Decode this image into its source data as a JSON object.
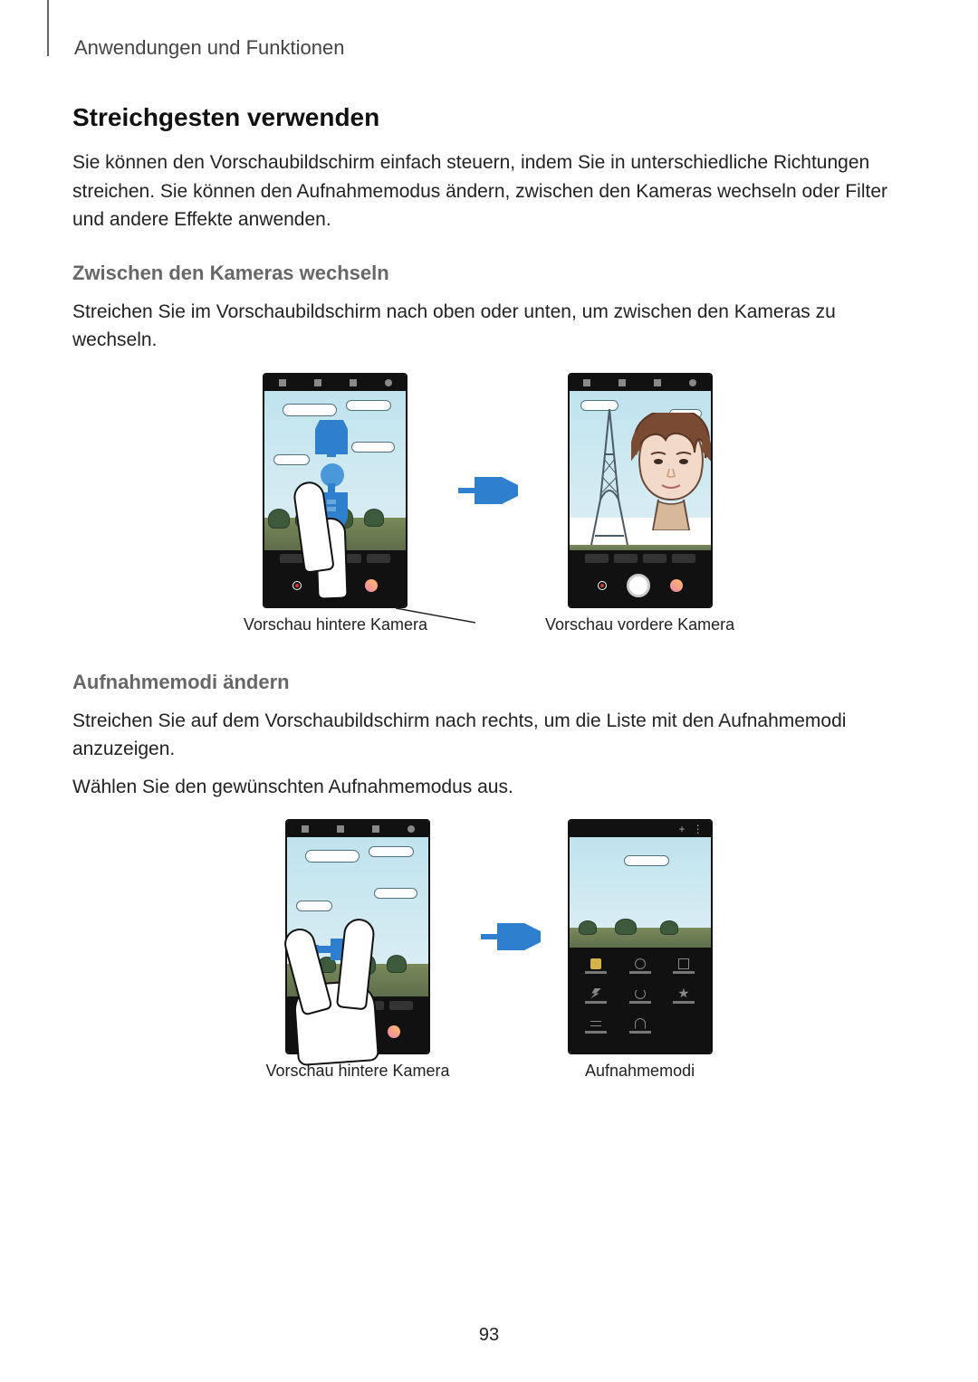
{
  "header": {
    "breadcrumb": "Anwendungen und Funktionen"
  },
  "section1": {
    "title": "Streichgesten verwenden",
    "intro": "Sie können den Vorschaubildschirm einfach steuern, indem Sie in unterschiedliche Richtungen streichen. Sie können den Aufnahmemodus ändern, zwischen den Kameras wechseln oder Filter und andere Effekte anwenden."
  },
  "section2": {
    "title": "Zwischen den Kameras wechseln",
    "text": "Streichen Sie im Vorschaubildschirm nach oben oder unten, um zwischen den Kameras zu wechseln.",
    "caption_left": "Vorschau hintere Kamera",
    "caption_right": "Vorschau vordere Kamera"
  },
  "section3": {
    "title": "Aufnahmemodi ändern",
    "text1": "Streichen Sie auf dem Vorschaubildschirm nach rechts, um die Liste mit den Aufnahmemodi anzuzeigen.",
    "text2": "Wählen Sie den gewünschten Aufnahmemodus aus.",
    "caption_left": "Vorschau hintere Kamera",
    "caption_right": "Aufnahmemodi"
  },
  "page_number": "93"
}
